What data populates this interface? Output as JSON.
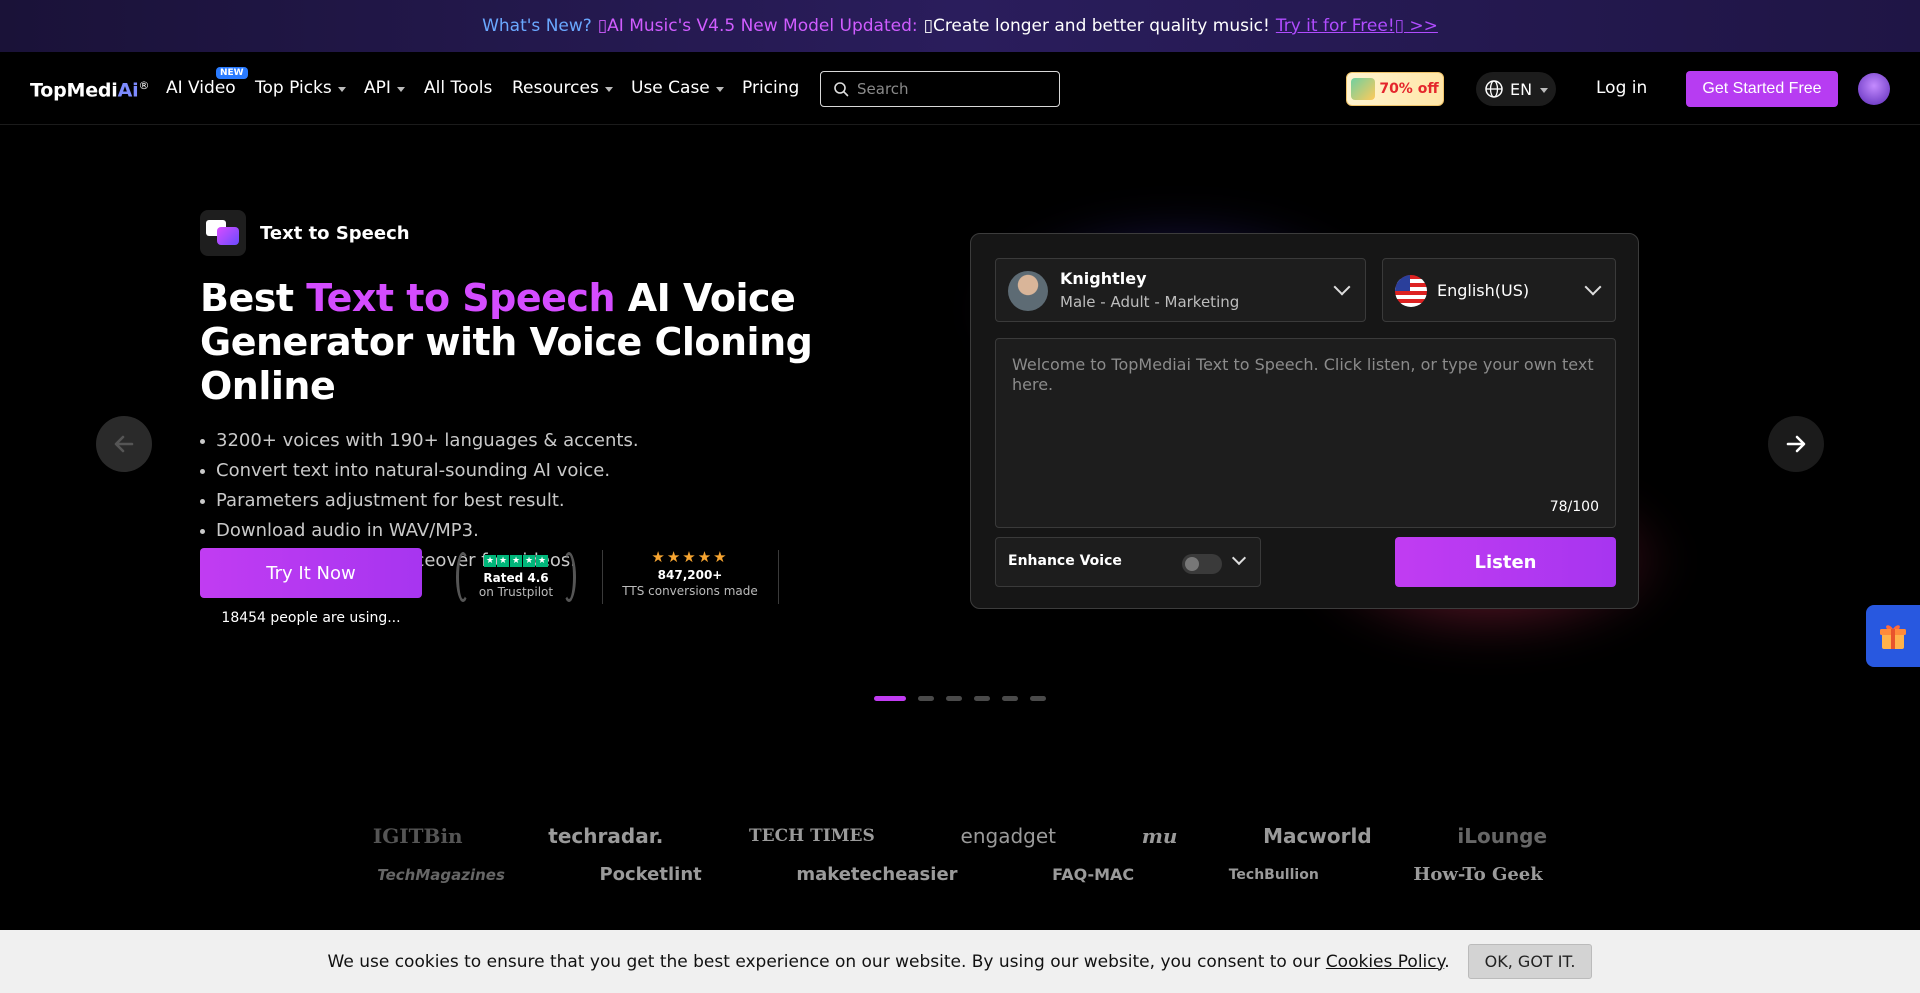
{
  "announcement": {
    "whats_new": "What's New?",
    "highlight": "▯AI Music's V4.5 New Model Updated:",
    "body": "▯Create longer and better quality music!",
    "link": "Try it for Free!▯ >>"
  },
  "nav": {
    "logo_main": "TopMedi",
    "logo_ai": "Ai",
    "logo_reg": "®",
    "items": {
      "ai_video": "AI Video",
      "new_badge": "NEW",
      "top_picks": "Top Picks",
      "api": "API",
      "all_tools": "All Tools",
      "resources": "Resources",
      "use_case": "Use Case",
      "pricing": "Pricing"
    },
    "search_placeholder": "Search",
    "promo": "70% off",
    "lang": "EN",
    "login": "Log in",
    "get_started": "Get Started Free"
  },
  "hero": {
    "product_name": "Text to Speech",
    "title_prefix": "Best ",
    "title_accent": "Text to Speech",
    "title_suffix": " AI Voice Generator with Voice Cloning Online",
    "bullets": [
      "3200+ voices with 190+ languages & accents.",
      "Convert text into natural-sounding AI voice.",
      "Parameters adjustment for best result.",
      "Download audio in WAV/MP3.",
      "Perfect for making voiceover for videos."
    ],
    "try_button": "Try It Now",
    "people_using": "18454 people are using...",
    "trustpilot_rated": "Rated 4.6",
    "trustpilot_on": "on Trustpilot",
    "conversions_count": "847,200+",
    "conversions_label": "TTS conversions made"
  },
  "widget": {
    "voice_name": "Knightley",
    "voice_desc": "Male - Adult - Marketing",
    "language": "English(US)",
    "text_placeholder": "Welcome to TopMediai Text to Speech. Click listen, or type your own text here.",
    "char_count": "78/100",
    "enhance_label": "Enhance Voice",
    "enhance_on": false,
    "listen_button": "Listen"
  },
  "carousel": {
    "total": 6,
    "active_index": 0
  },
  "press_logos": {
    "row1": [
      "IGITBin",
      "techradar.",
      "TECH TIMES",
      "engadget",
      "mu",
      "Macworld",
      "iLounge"
    ],
    "row2": [
      "TechMagazines",
      "Pocketlint",
      "maketecheasier",
      "FAQ-MAC",
      "TechBullion",
      "How-To Geek"
    ]
  },
  "cookie": {
    "text": "We use cookies to ensure that you get the best experience on our website. By using our website, you consent to our",
    "link": "Cookies Policy",
    "period": ".",
    "ok_button": "OK, GOT IT."
  },
  "colors": {
    "accent": "#c13cf2",
    "accent_text": "#d44cff",
    "announcement_link": "#b04cff"
  }
}
